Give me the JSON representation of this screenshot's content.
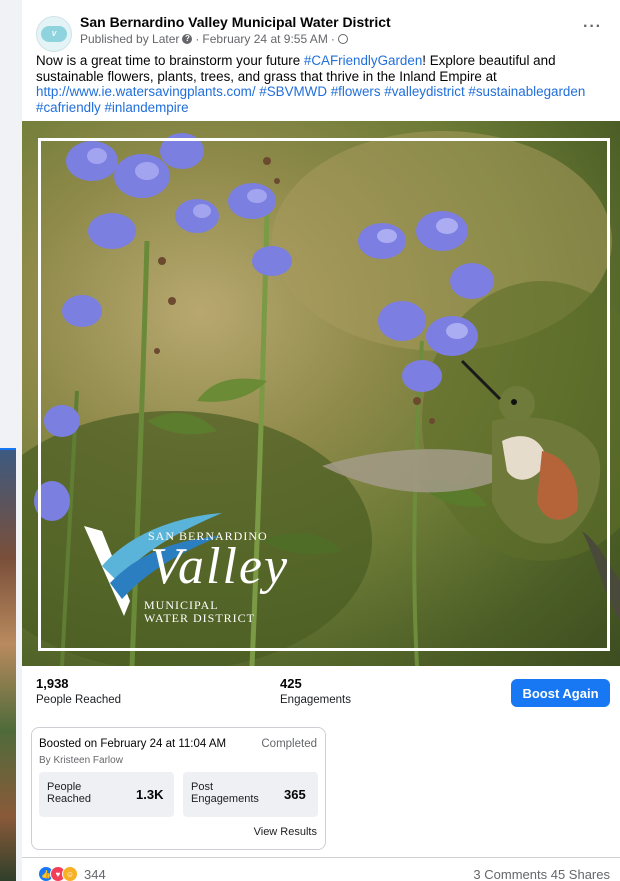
{
  "post": {
    "page_name": "San Bernardino Valley Municipal Water District",
    "published_by": "Published by Later",
    "date": "February 24 at 9:55 AM",
    "more_icon": "more-horizontal-icon",
    "caption": {
      "part1": "Now is a great time to brainstorm your future ",
      "hashtag1": "#CAFriendlyGarden",
      "part2": "! Explore beautiful and sustainable flowers, plants, trees, and grass that thrive in the Inland Empire at ",
      "link": "http://www.ie.watersavingplants.com/",
      "hashtags": " #SBVMWD #flowers #valleydistrict #sustainablegarden #cafriendly #inlandempire"
    },
    "image_logo": {
      "line1": "San Bernardino",
      "line2": "Valley",
      "line3": "Municipal",
      "line4": "Water District"
    }
  },
  "stats": {
    "people_reached_value": "1,938",
    "people_reached_label": "People Reached",
    "engagements_value": "425",
    "engagements_label": "Engagements",
    "boost_button": "Boost Again"
  },
  "boost_card": {
    "title": "Boosted on February 24 at 11:04 AM",
    "status": "Completed",
    "by": "By Kristeen Farlow",
    "people_reached_label_1": "People",
    "people_reached_label_2": "Reached",
    "people_reached_value": "1.3K",
    "post_engagements_label_1": "Post",
    "post_engagements_label_2": "Engagements",
    "post_engagements_value": "365",
    "view_results": "View Results"
  },
  "footer": {
    "reaction_count": "344",
    "comments_shares": "3 Comments  45 Shares"
  },
  "colors": {
    "accent": "#1877f2",
    "link": "#216fdb",
    "secondary_text": "#65676b"
  }
}
